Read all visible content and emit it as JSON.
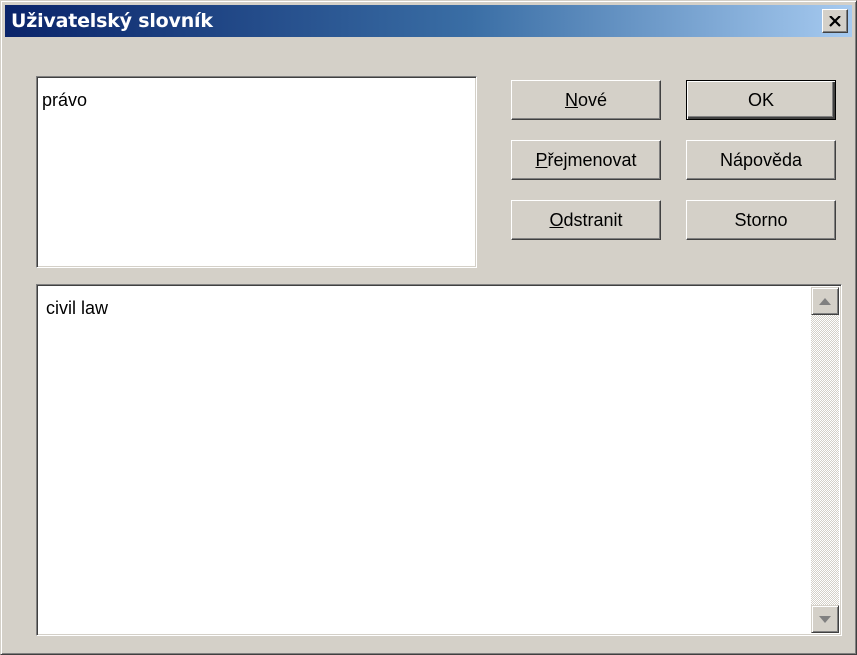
{
  "window": {
    "title": "Uživatelský slovník",
    "close_label": "×"
  },
  "word_field": {
    "value": "právo"
  },
  "definition_area": {
    "value": "civil law"
  },
  "buttons": {
    "new": {
      "accel": "N",
      "rest": "ové"
    },
    "rename": {
      "accel": "P",
      "rest": "řejmenovat"
    },
    "delete": {
      "accel": "O",
      "rest": "dstranit"
    },
    "ok": "OK",
    "help": "Nápověda",
    "cancel": "Storno"
  },
  "colors": {
    "title_gradient_start": "#0a246a",
    "title_gradient_end": "#a6caf0",
    "face": "#d4d0c8"
  }
}
